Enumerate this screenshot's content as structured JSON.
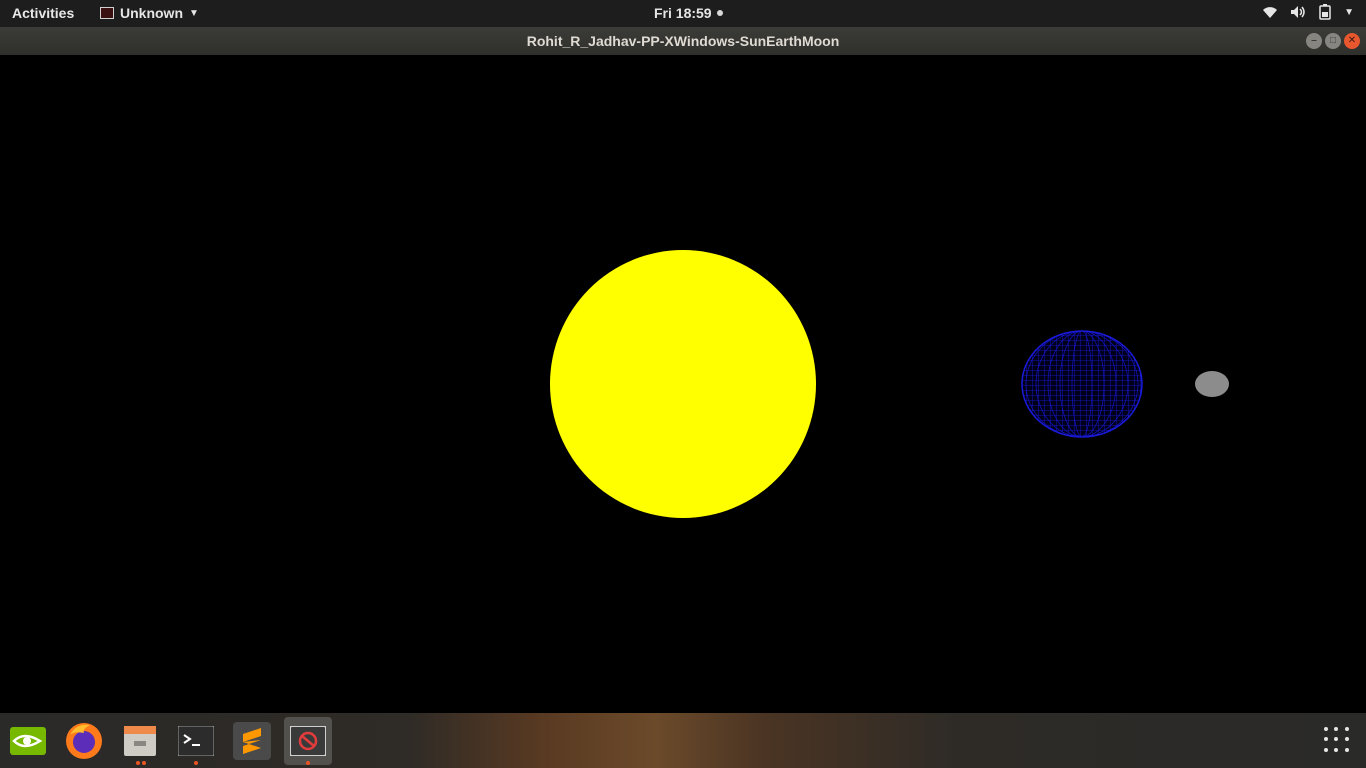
{
  "topbar": {
    "activities": "Activities",
    "app_name": "Unknown",
    "clock": "Fri 18:59"
  },
  "window": {
    "title": "Rohit_R_Jadhav-PP-XWindows-SunEarthMoon"
  },
  "scene": {
    "sun_color": "#ffff00",
    "earth_color": "#0a0ab4",
    "moon_color": "#8c8c8c"
  },
  "dock": {
    "items": [
      "nvidia-settings",
      "firefox",
      "files",
      "terminal",
      "sublime-text",
      "xwindows-app"
    ]
  }
}
